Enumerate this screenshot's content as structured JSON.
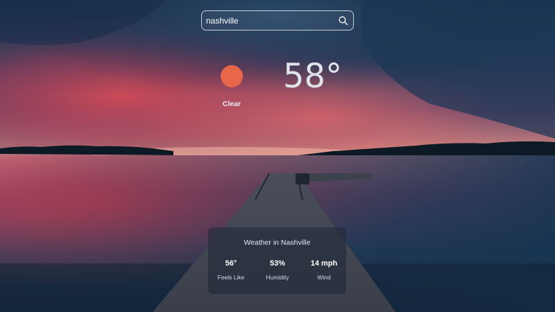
{
  "search": {
    "value": "nashville",
    "placeholder": "",
    "button_icon": "search-icon"
  },
  "current": {
    "condition": "Clear",
    "condition_icon": "sun-icon",
    "condition_icon_color": "#e8674a",
    "temperature": "58°"
  },
  "details": {
    "title": "Weather in Nashville",
    "metrics": [
      {
        "value": "56°",
        "label": "Feels Like"
      },
      {
        "value": "53%",
        "label": "Humidity"
      },
      {
        "value": "14 mph",
        "label": "Wind"
      }
    ]
  },
  "background": {
    "scene": "sunset over lake with wooden pier",
    "colors": {
      "sky_top": "#1d3350",
      "sunset_red": "#c2484f",
      "horizon_glow": "#e38a7a",
      "water_dark": "#1a3046"
    }
  }
}
